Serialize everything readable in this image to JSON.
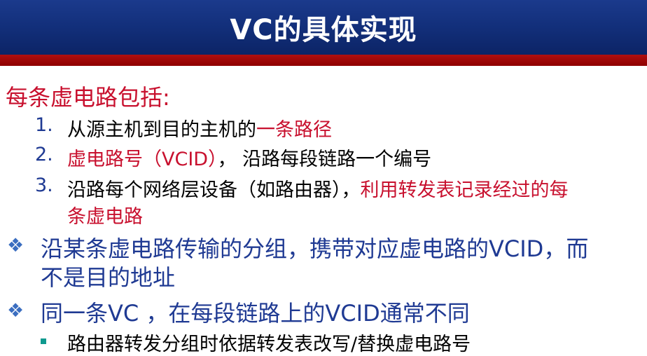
{
  "slide": {
    "title": "VC的具体实现",
    "intro": "每条虚电路包括:",
    "items": [
      {
        "num": "1.",
        "text_a": "从源主机到目的主机的",
        "text_b": "一条路径"
      },
      {
        "num": "2.",
        "text_a": "虚电路号（VCID）",
        "text_b": "， 沿路每段链路一个编号"
      },
      {
        "num": "3.",
        "text_a": "沿路每个网络层设备（如路由器），",
        "text_b": "利用转发表记录经过的每",
        "text_c": "条虚电路"
      }
    ],
    "bullets": [
      {
        "glyph": "❖",
        "line1": "沿某条虚电路传输的分组，携带对应虚电路的VCID，而",
        "line2": "不是目的地址"
      },
      {
        "glyph": "❖",
        "line1": "同一条VC ，在每段链路上的VCID通常不同"
      }
    ],
    "sub_bullet": {
      "text": "路由器转发分组时依据转发表改写/替换虚电路号"
    }
  }
}
